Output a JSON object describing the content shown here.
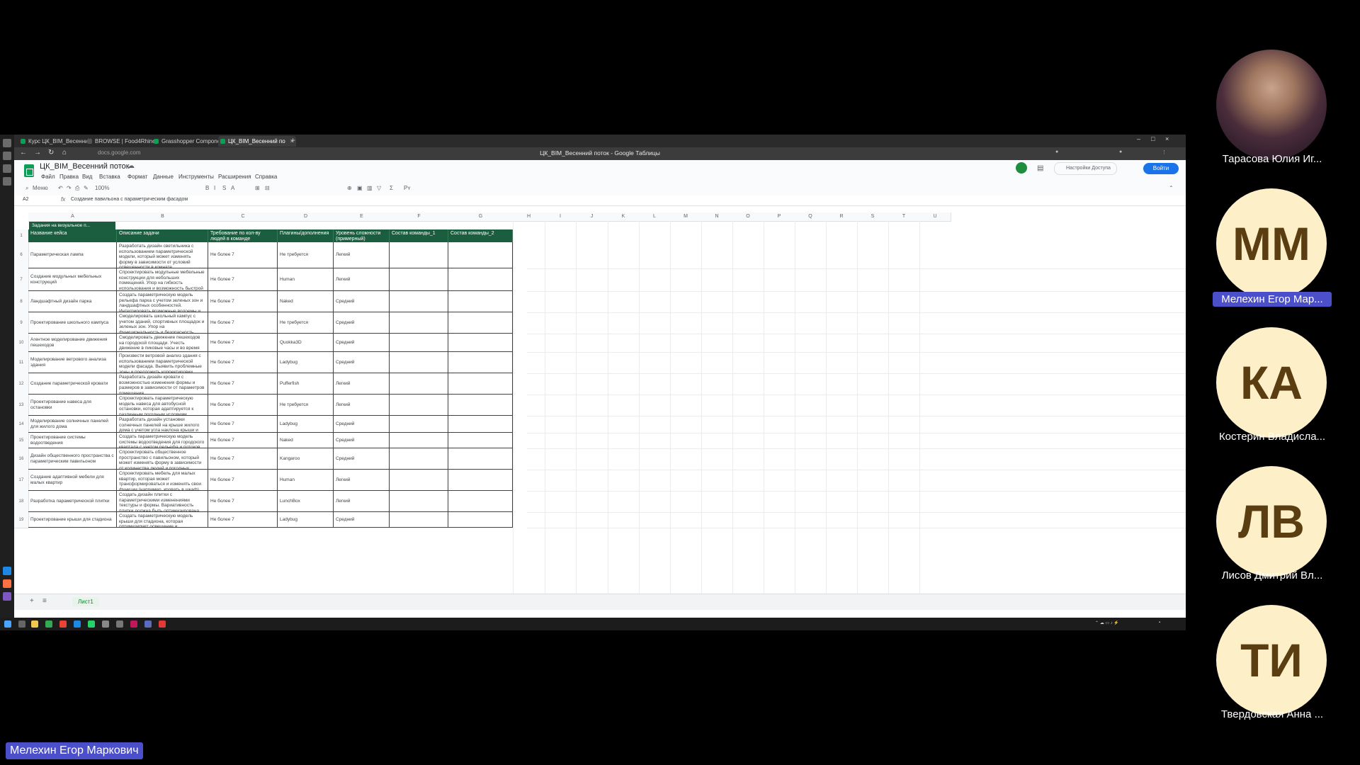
{
  "browser": {
    "tabs": [
      {
        "label": "Курс ЦК_BIM_Весенний"
      },
      {
        "label": "BROWSE | Food4Rhino"
      },
      {
        "label": "Grasshopper Component"
      },
      {
        "label": "ЦК_BIM_Весенний по"
      }
    ],
    "url": "docs.google.com",
    "window_title": "ЦК_BIM_Весенний поток - Google Таблицы"
  },
  "sheets": {
    "doc_title": "ЦК_BIM_Весенний поток",
    "menu": [
      "Файл",
      "Правка",
      "Вид",
      "Вставка",
      "Формат",
      "Данные",
      "Инструменты",
      "Расширения",
      "Справка"
    ],
    "search_label": "Меню",
    "zoom": "100%",
    "share_label": "Настройки Доступа",
    "login_label": "Войти",
    "name_box": "A2",
    "formula": "Создание павильона с параметрическим фасадом",
    "filter_chip": "Задания на визуальное п...",
    "sheet_tab": "Лист1"
  },
  "columns": [
    "A",
    "B",
    "C",
    "D",
    "E",
    "F",
    "G",
    "H",
    "I",
    "J",
    "K",
    "L",
    "M",
    "N",
    "O",
    "P",
    "Q",
    "R",
    "S",
    "T",
    "U"
  ],
  "table": {
    "headers": [
      "Название кейса",
      "Описание задачи",
      "Требование по кол-ву людей в команде",
      "Плагины/дополнения",
      "Уровень сложности (примерный)",
      "Состав команды_1",
      "Состав команды_2"
    ],
    "rows": [
      {
        "n": "6",
        "case": "Параметрическая лампа",
        "desc": "Разработать дизайн светильника с использованием параметрической модели, который может изменять форму в зависимости от условий освещенности в комнате.",
        "team": "Не более 7",
        "plugin": "Не требуется",
        "level": "Легкий"
      },
      {
        "n": "7",
        "case": "Создание модульных мебельных конструкций",
        "desc": "Спроектировать модульные мебельные конструкции для небольших помещений. Упор на гибкость использования и возможность быстрой сборки-разборки.",
        "team": "Не более 7",
        "plugin": "Human",
        "level": "Легкий"
      },
      {
        "n": "8",
        "case": "Ландшафтный дизайн парка",
        "desc": "Создать параметрическую модель рельефа парка с учетом зеленых зон и ландшафтных особенностей. Интегрировать возможные водоемы и зоны отдыха.",
        "team": "Не более 7",
        "plugin": "Naked",
        "level": "Средний"
      },
      {
        "n": "9",
        "case": "Проектирование школьного кампуса",
        "desc": "Смоделировать школьный кампус с учетом зданий, спортивных площадок и зеленых зон. Упор на функциональность и безопасность территории.",
        "team": "Не более 7",
        "plugin": "Не требуется",
        "level": "Средний"
      },
      {
        "n": "10",
        "case": "Агентное моделирование движения пешеходов",
        "desc": "Смоделировать движение пешеходов на городской площади. Учесть движение в пиковые часы и во время мероприятий.",
        "team": "Не более 7",
        "plugin": "Quokka3D",
        "level": "Средний"
      },
      {
        "n": "11",
        "case": "Моделирование ветрового анализа здания",
        "desc": "Произвести ветровой анализ здания с использованием параметрической модели фасада. Выявить проблемные зоны и предложить корректировки.",
        "team": "Не более 7",
        "plugin": "Ladybug",
        "level": "Средний"
      },
      {
        "n": "12",
        "case": "Создание параметрической кровати",
        "desc": "Разработать дизайн кровати с возможностью изменения формы и размеров в зависимости от параметров помещения.",
        "team": "Не более 7",
        "plugin": "Pufferfish",
        "level": "Легкий"
      },
      {
        "n": "13",
        "case": "Проектирование навеса для остановки",
        "desc": "Спроектировать параметрическую модель навеса для автобусной остановки, которая адаптируется к различным погодным условиям.",
        "team": "Не более 7",
        "plugin": "Не требуется",
        "level": "Легкий"
      },
      {
        "n": "14",
        "case": "Моделирование солнечных панелей для жилого дома",
        "desc": "Разработать дизайн установки солнечных панелей на крыше жилого дома с учетом угла наклона крыши и солнца.",
        "team": "Не более 7",
        "plugin": "Ladybug",
        "level": "Средний"
      },
      {
        "n": "15",
        "case": "Проектирование системы водоотведения",
        "desc": "Создать параметрическую модель системы водоотведения для городского квартала с учетом рельефа и потоков воды.",
        "team": "Не более 7",
        "plugin": "Naked",
        "level": "Средний"
      },
      {
        "n": "16",
        "case": "Дизайн общественного пространства с параметрическим павильоном",
        "desc": "Спроектировать общественное пространство с павильоном, который может изменять форму в зависимости от количества людей и погодных условий.",
        "team": "Не более 7",
        "plugin": "Kangaroo",
        "level": "Средний"
      },
      {
        "n": "17",
        "case": "Создание адаптивной мебели для малых квартир",
        "desc": "Спроектировать мебель для малых квартир, которая может трансформироваться и изменять свои функции (например, кровать в шкаф).",
        "team": "Не более 7",
        "plugin": "Human",
        "level": "Легкий"
      },
      {
        "n": "18",
        "case": "Разработка параметрической плитки",
        "desc": "Создать дизайн плитки с параметрическими изменениями текстуры и формы. Вариативность плитки должна быть оптимизирована для производства.",
        "team": "Не более 7",
        "plugin": "LunchBox",
        "level": "Легкий"
      },
      {
        "n": "19",
        "case": "Проектирование крыши для стадиона",
        "desc": "Создать параметрическую модель крыши для стадиона, которая оптимизирует освещение и вентиляцию.",
        "team": "Не более 7",
        "plugin": "Ladybug",
        "level": "Средний"
      }
    ]
  },
  "participants": [
    {
      "initials": "",
      "name": "Тарасова Юлия Иг..."
    },
    {
      "initials": "ММ",
      "name": "Мелехин Егор Мар..."
    },
    {
      "initials": "КА",
      "name": "Костерин Владисла..."
    },
    {
      "initials": "ЛВ",
      "name": "Лисов Дмитрий Вл..."
    },
    {
      "initials": "ТИ",
      "name": "Твердовская Анна ..."
    }
  ],
  "active_speaker": "Мелехин Егор Маркович",
  "colors": {
    "header_green": "#1b5e3f",
    "speaker_highlight": "#4b4fc9",
    "avatar_bg": "#fdefc7",
    "login_blue": "#1a73e8"
  }
}
